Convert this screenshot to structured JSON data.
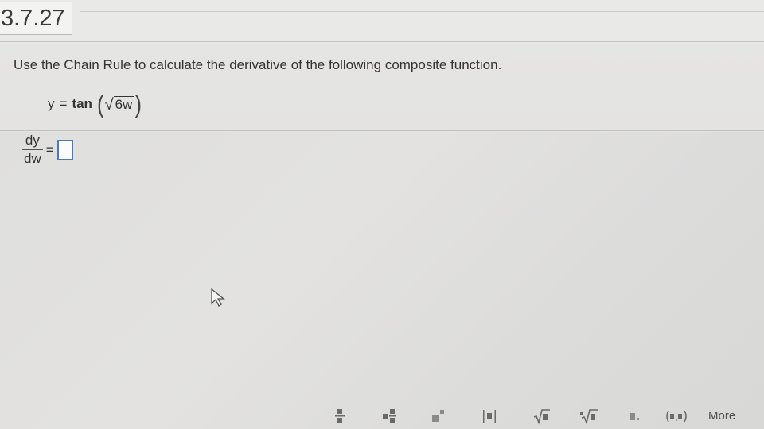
{
  "problem": {
    "number": "3.7.27",
    "instruction": "Use the Chain Rule to calculate the derivative of the following composite function.",
    "equation": {
      "lhs": "y",
      "equals": "=",
      "function": "tan",
      "radicand": "6w"
    }
  },
  "answer": {
    "numerator": "dy",
    "denominator": "dw",
    "equals": "=",
    "value": ""
  },
  "toolbar": {
    "icons": [
      "fraction-icon",
      "mixed-number-icon",
      "exponent-icon",
      "absolute-value-icon",
      "square-root-icon",
      "nth-root-icon",
      "decimal-icon",
      "ordered-pair-icon"
    ],
    "more_label": "More"
  },
  "colors": {
    "answer_box_border": "#4a78b8",
    "background": "#e2e1df"
  }
}
